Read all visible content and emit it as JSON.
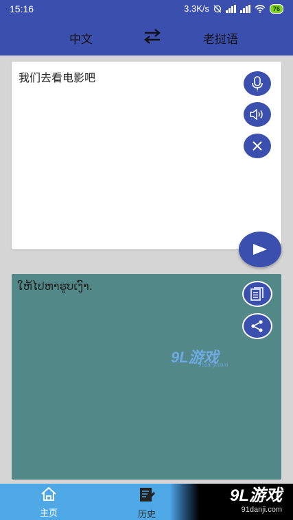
{
  "status_bar": {
    "time": "15:16",
    "net_speed": "3.3K/s",
    "battery": "76"
  },
  "toolbar": {
    "source_language": "中文",
    "target_language": "老挝语",
    "swap_icon": "swap-arrows-icon"
  },
  "input": {
    "text": "我们去看电影吧",
    "mic_icon": "microphone-icon",
    "speaker_icon": "speaker-icon",
    "clear_icon": "close-icon",
    "send_icon": "send-icon"
  },
  "output": {
    "text": "ໃຫ້ໄປຫາຮູບເງົາ.",
    "copy_icon": "copy-icon",
    "share_icon": "share-icon",
    "watermark_main": "9L游戏",
    "watermark_sub": "91danji.com"
  },
  "bottom_nav": {
    "items": [
      {
        "label": "主页",
        "icon": "home-icon",
        "active": true
      },
      {
        "label": "历史",
        "icon": "history-icon",
        "active": false
      }
    ]
  },
  "brand": {
    "main": "9L游戏",
    "sub": "91danji.com"
  },
  "colors": {
    "primary": "#3a4fae",
    "output_background": "#528888",
    "nav_background": "#4fa8e6"
  }
}
